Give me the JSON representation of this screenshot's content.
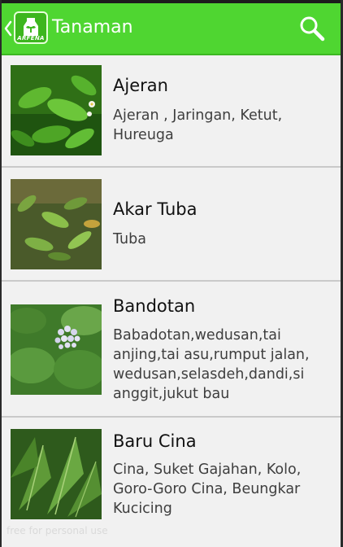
{
  "app": {
    "title": "Tanaman",
    "logo_text": "ARFENA",
    "back_icon": "chevron-left-icon",
    "search_icon": "search-icon",
    "accent_color": "#4fd631"
  },
  "plants": [
    {
      "name": "Ajeran",
      "aliases": "Ajeran , Jaringan, Ketut, Hureuga"
    },
    {
      "name": "Akar Tuba",
      "aliases": "Tuba"
    },
    {
      "name": "Bandotan",
      "aliases": "Babadotan,wedusan,tai anjing,tai asu,rumput jalan, wedusan,selasdeh,dandi,si anggit,jukut bau"
    },
    {
      "name": "Baru Cina",
      "aliases": "Cina, Suket Gajahan, Kolo, Goro-Goro Cina, Beungkar Kucicing"
    }
  ],
  "watermark": "free for personal use"
}
